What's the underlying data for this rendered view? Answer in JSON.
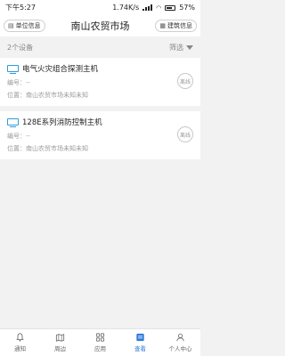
{
  "status_bar": {
    "time": "下午5:27",
    "network_speed": "1.74K/s",
    "battery": "57%"
  },
  "header": {
    "left_button": "单位信息",
    "title": "南山农贸市场",
    "right_button": "建筑信息"
  },
  "toolbar": {
    "count_text": "2个设备",
    "filter_label": "筛选"
  },
  "devices": [
    {
      "name": "电气火灾组合探测主机",
      "code_label": "编号：--",
      "location_label": "位置：南山农贸市场未知未知",
      "status": "离线"
    },
    {
      "name": "128E系列消防控制主机",
      "code_label": "编号：--",
      "location_label": "位置：南山农贸市场未知未知",
      "status": "离线"
    }
  ],
  "tabs": [
    {
      "label": "通知",
      "icon": "bell-icon"
    },
    {
      "label": "周边",
      "icon": "map-icon"
    },
    {
      "label": "应用",
      "icon": "apps-icon"
    },
    {
      "label": "查看",
      "icon": "view-icon"
    },
    {
      "label": "个人中心",
      "icon": "person-icon"
    }
  ],
  "colors": {
    "accent": "#2f7bd8",
    "device_icon": "#2f9bd8"
  }
}
